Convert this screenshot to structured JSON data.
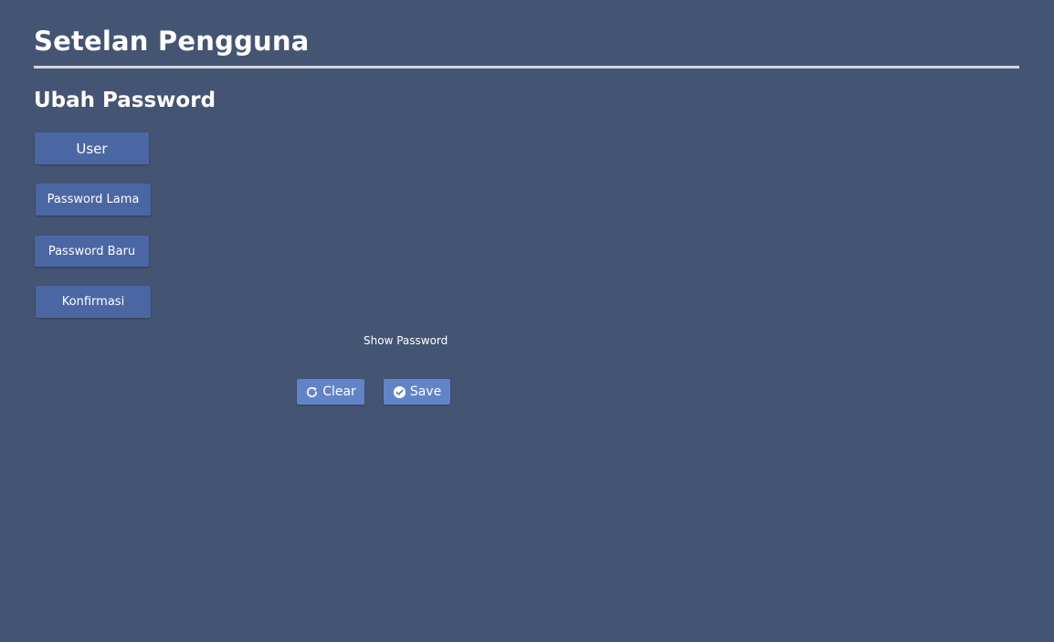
{
  "page": {
    "title": "Setelan Pengguna",
    "section_title": "Ubah Password"
  },
  "fields": {
    "user_label": "User",
    "old_password_label": "Password Lama",
    "new_password_label": "Password Baru",
    "confirm_label": "Konfirmasi"
  },
  "show_password_label": "Show Password",
  "actions": {
    "clear_label": "Clear",
    "clear_icon": "refresh-icon",
    "save_label": "Save",
    "save_icon": "check-circle-icon"
  },
  "colors": {
    "background": "#445473",
    "label_background": "#4b67a3",
    "button_background": "#6184c9",
    "divider": "#d4d7de",
    "text": "#ffffff"
  }
}
